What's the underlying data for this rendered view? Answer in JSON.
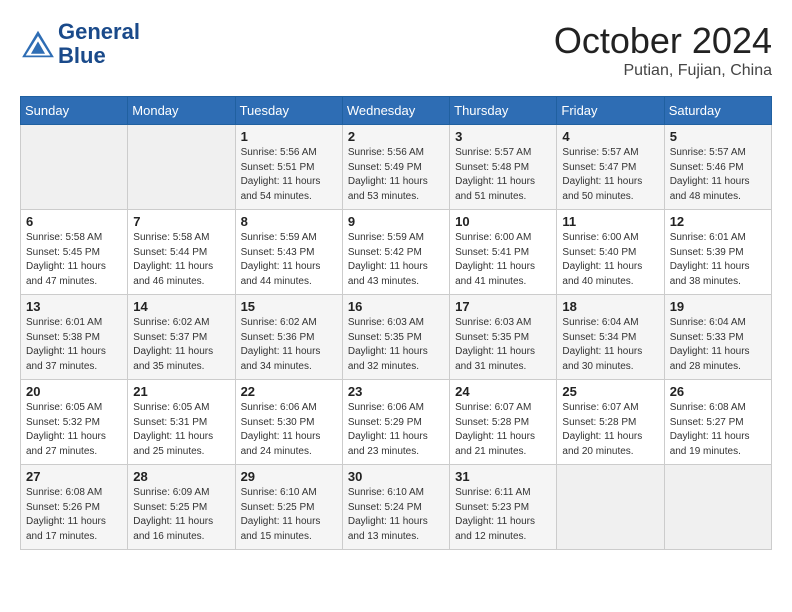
{
  "header": {
    "logo_line1": "General",
    "logo_line2": "Blue",
    "month_year": "October 2024",
    "location": "Putian, Fujian, China"
  },
  "weekdays": [
    "Sunday",
    "Monday",
    "Tuesday",
    "Wednesday",
    "Thursday",
    "Friday",
    "Saturday"
  ],
  "weeks": [
    [
      {
        "day": "",
        "info": ""
      },
      {
        "day": "",
        "info": ""
      },
      {
        "day": "1",
        "info": "Sunrise: 5:56 AM\nSunset: 5:51 PM\nDaylight: 11 hours\nand 54 minutes."
      },
      {
        "day": "2",
        "info": "Sunrise: 5:56 AM\nSunset: 5:49 PM\nDaylight: 11 hours\nand 53 minutes."
      },
      {
        "day": "3",
        "info": "Sunrise: 5:57 AM\nSunset: 5:48 PM\nDaylight: 11 hours\nand 51 minutes."
      },
      {
        "day": "4",
        "info": "Sunrise: 5:57 AM\nSunset: 5:47 PM\nDaylight: 11 hours\nand 50 minutes."
      },
      {
        "day": "5",
        "info": "Sunrise: 5:57 AM\nSunset: 5:46 PM\nDaylight: 11 hours\nand 48 minutes."
      }
    ],
    [
      {
        "day": "6",
        "info": "Sunrise: 5:58 AM\nSunset: 5:45 PM\nDaylight: 11 hours\nand 47 minutes."
      },
      {
        "day": "7",
        "info": "Sunrise: 5:58 AM\nSunset: 5:44 PM\nDaylight: 11 hours\nand 46 minutes."
      },
      {
        "day": "8",
        "info": "Sunrise: 5:59 AM\nSunset: 5:43 PM\nDaylight: 11 hours\nand 44 minutes."
      },
      {
        "day": "9",
        "info": "Sunrise: 5:59 AM\nSunset: 5:42 PM\nDaylight: 11 hours\nand 43 minutes."
      },
      {
        "day": "10",
        "info": "Sunrise: 6:00 AM\nSunset: 5:41 PM\nDaylight: 11 hours\nand 41 minutes."
      },
      {
        "day": "11",
        "info": "Sunrise: 6:00 AM\nSunset: 5:40 PM\nDaylight: 11 hours\nand 40 minutes."
      },
      {
        "day": "12",
        "info": "Sunrise: 6:01 AM\nSunset: 5:39 PM\nDaylight: 11 hours\nand 38 minutes."
      }
    ],
    [
      {
        "day": "13",
        "info": "Sunrise: 6:01 AM\nSunset: 5:38 PM\nDaylight: 11 hours\nand 37 minutes."
      },
      {
        "day": "14",
        "info": "Sunrise: 6:02 AM\nSunset: 5:37 PM\nDaylight: 11 hours\nand 35 minutes."
      },
      {
        "day": "15",
        "info": "Sunrise: 6:02 AM\nSunset: 5:36 PM\nDaylight: 11 hours\nand 34 minutes."
      },
      {
        "day": "16",
        "info": "Sunrise: 6:03 AM\nSunset: 5:35 PM\nDaylight: 11 hours\nand 32 minutes."
      },
      {
        "day": "17",
        "info": "Sunrise: 6:03 AM\nSunset: 5:35 PM\nDaylight: 11 hours\nand 31 minutes."
      },
      {
        "day": "18",
        "info": "Sunrise: 6:04 AM\nSunset: 5:34 PM\nDaylight: 11 hours\nand 30 minutes."
      },
      {
        "day": "19",
        "info": "Sunrise: 6:04 AM\nSunset: 5:33 PM\nDaylight: 11 hours\nand 28 minutes."
      }
    ],
    [
      {
        "day": "20",
        "info": "Sunrise: 6:05 AM\nSunset: 5:32 PM\nDaylight: 11 hours\nand 27 minutes."
      },
      {
        "day": "21",
        "info": "Sunrise: 6:05 AM\nSunset: 5:31 PM\nDaylight: 11 hours\nand 25 minutes."
      },
      {
        "day": "22",
        "info": "Sunrise: 6:06 AM\nSunset: 5:30 PM\nDaylight: 11 hours\nand 24 minutes."
      },
      {
        "day": "23",
        "info": "Sunrise: 6:06 AM\nSunset: 5:29 PM\nDaylight: 11 hours\nand 23 minutes."
      },
      {
        "day": "24",
        "info": "Sunrise: 6:07 AM\nSunset: 5:28 PM\nDaylight: 11 hours\nand 21 minutes."
      },
      {
        "day": "25",
        "info": "Sunrise: 6:07 AM\nSunset: 5:28 PM\nDaylight: 11 hours\nand 20 minutes."
      },
      {
        "day": "26",
        "info": "Sunrise: 6:08 AM\nSunset: 5:27 PM\nDaylight: 11 hours\nand 19 minutes."
      }
    ],
    [
      {
        "day": "27",
        "info": "Sunrise: 6:08 AM\nSunset: 5:26 PM\nDaylight: 11 hours\nand 17 minutes."
      },
      {
        "day": "28",
        "info": "Sunrise: 6:09 AM\nSunset: 5:25 PM\nDaylight: 11 hours\nand 16 minutes."
      },
      {
        "day": "29",
        "info": "Sunrise: 6:10 AM\nSunset: 5:25 PM\nDaylight: 11 hours\nand 15 minutes."
      },
      {
        "day": "30",
        "info": "Sunrise: 6:10 AM\nSunset: 5:24 PM\nDaylight: 11 hours\nand 13 minutes."
      },
      {
        "day": "31",
        "info": "Sunrise: 6:11 AM\nSunset: 5:23 PM\nDaylight: 11 hours\nand 12 minutes."
      },
      {
        "day": "",
        "info": ""
      },
      {
        "day": "",
        "info": ""
      }
    ]
  ]
}
